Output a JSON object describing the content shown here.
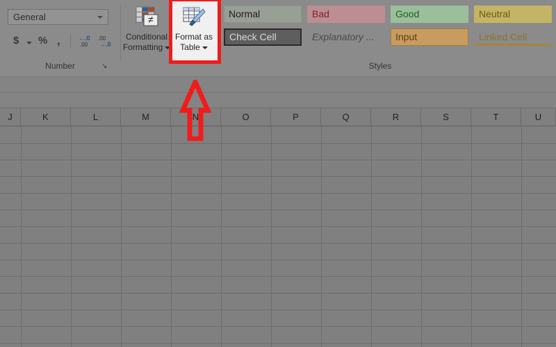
{
  "ribbon": {
    "number_group": {
      "label": "Number",
      "format_select": {
        "value": "General",
        "caret": "chevron-down-icon"
      },
      "buttons": [
        {
          "name": "accounting-number-format",
          "glyph": "$"
        },
        {
          "name": "percent-style",
          "glyph": "%"
        },
        {
          "name": "comma-style",
          "glyph": ","
        },
        {
          "name": "increase-decimal",
          "top": "←.0",
          "bottom": ".00"
        },
        {
          "name": "decrease-decimal",
          "top": ".00",
          "bottom": "→.0"
        }
      ],
      "dialog_launcher": "↘"
    },
    "styles_group": {
      "label": "Styles",
      "conditional_formatting": {
        "line1": "Conditional",
        "line2": "Formatting"
      },
      "format_as_table": {
        "line1": "Format as",
        "line2": "Table"
      },
      "gallery": {
        "row1": [
          {
            "label": "Normal",
            "class": "sc-normal"
          },
          {
            "label": "Bad",
            "class": "sc-bad"
          },
          {
            "label": "Good",
            "class": "sc-good"
          },
          {
            "label": "Neutral",
            "class": "sc-neutral"
          }
        ],
        "row2": [
          {
            "label": "Check Cell",
            "class": "sc-checkcell"
          },
          {
            "label": "Explanatory ...",
            "class": "sc-explanatory"
          },
          {
            "label": "Input",
            "class": "sc-input"
          },
          {
            "label": "Linked Cell",
            "class": "sc-linked"
          }
        ]
      }
    }
  },
  "sheet": {
    "columns": [
      "J",
      "K",
      "L",
      "M",
      "N",
      "O",
      "P",
      "Q",
      "R",
      "S",
      "T",
      "U"
    ]
  },
  "annotations": {
    "highlight_target": "Format as Table",
    "arrow": "up-arrow-callout",
    "accent_color": "#ee1c1c"
  }
}
